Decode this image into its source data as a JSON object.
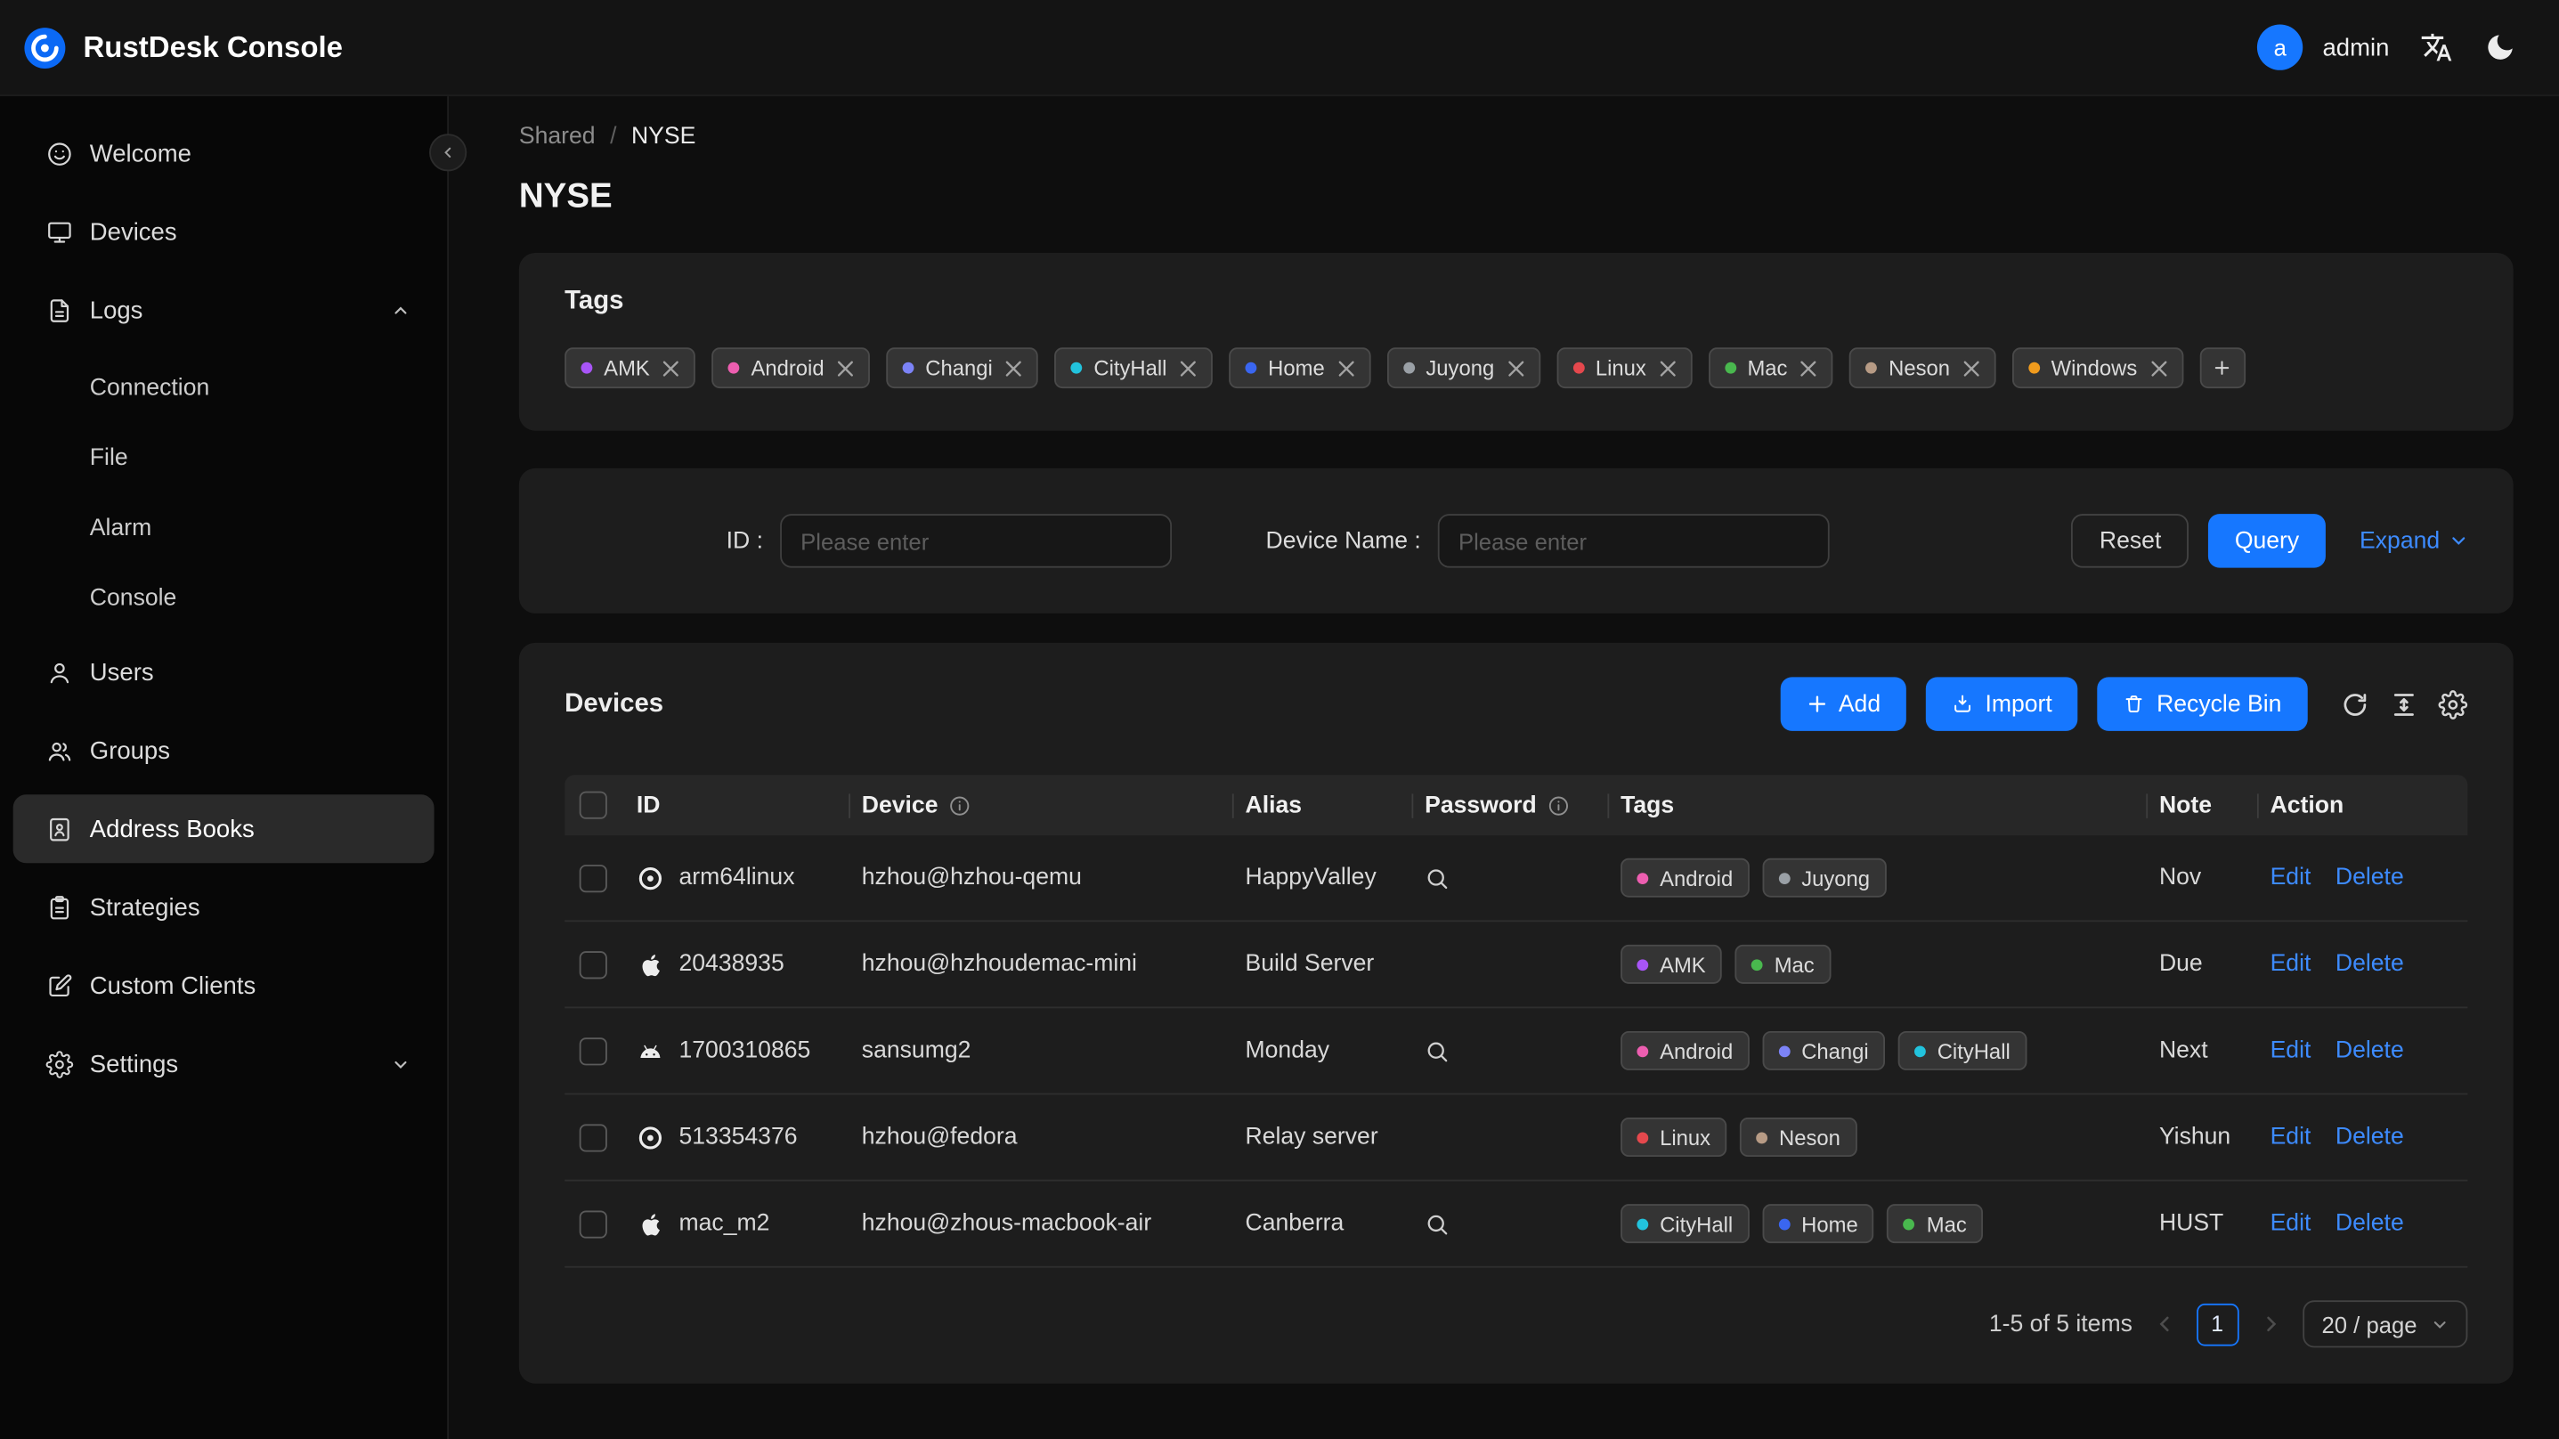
{
  "header": {
    "title": "RustDesk Console",
    "user_initial": "a",
    "user_name": "admin"
  },
  "sidebar": {
    "items": [
      {
        "label": "Welcome",
        "icon": "smiley-icon"
      },
      {
        "label": "Devices",
        "icon": "monitor-icon"
      },
      {
        "label": "Logs",
        "icon": "document-icon",
        "expanded": true
      },
      {
        "label": "Users",
        "icon": "user-icon"
      },
      {
        "label": "Groups",
        "icon": "users-icon"
      },
      {
        "label": "Address Books",
        "icon": "address-book-icon",
        "active": true
      },
      {
        "label": "Strategies",
        "icon": "clipboard-icon"
      },
      {
        "label": "Custom Clients",
        "icon": "edit-square-icon"
      },
      {
        "label": "Settings",
        "icon": "gear-icon",
        "collapsed": true
      }
    ],
    "logs_submenu": [
      {
        "label": "Connection"
      },
      {
        "label": "File"
      },
      {
        "label": "Alarm"
      },
      {
        "label": "Console"
      }
    ],
    "active_item": "Address Books"
  },
  "breadcrumb": {
    "parent": "Shared",
    "separator": "/",
    "current": "NYSE"
  },
  "page_title": "NYSE",
  "tags_card": {
    "title": "Tags",
    "tags": [
      {
        "label": "AMK",
        "color": "#a855f7"
      },
      {
        "label": "Android",
        "color": "#ed5eb0"
      },
      {
        "label": "Changi",
        "color": "#7c83f7"
      },
      {
        "label": "CityHall",
        "color": "#22c3dd"
      },
      {
        "label": "Home",
        "color": "#3a66f0"
      },
      {
        "label": "Juyong",
        "color": "#9aa0a6"
      },
      {
        "label": "Linux",
        "color": "#e5484d"
      },
      {
        "label": "Mac",
        "color": "#49b84e"
      },
      {
        "label": "Neson",
        "color": "#b79b85"
      },
      {
        "label": "Windows",
        "color": "#f09b1d"
      }
    ]
  },
  "filter": {
    "id_label": "ID :",
    "id_placeholder": "Please enter",
    "device_label": "Device Name :",
    "device_placeholder": "Please enter",
    "reset": "Reset",
    "query": "Query",
    "expand": "Expand"
  },
  "devices": {
    "title": "Devices",
    "add": "Add",
    "import": "Import",
    "recycle_bin": "Recycle Bin",
    "columns": {
      "id": "ID",
      "device": "Device",
      "alias": "Alias",
      "password": "Password",
      "tags": "Tags",
      "note": "Note",
      "action": "Action"
    },
    "actions": {
      "edit": "Edit",
      "delete": "Delete"
    },
    "rows": [
      {
        "os_icon": "linux-os-icon",
        "id": "arm64linux",
        "device": "hzhou@hzhou-qemu",
        "alias": "HappyValley",
        "password_hidden": true,
        "tags": [
          {
            "label": "Android",
            "color": "#ed5eb0"
          },
          {
            "label": "Juyong",
            "color": "#9aa0a6"
          }
        ],
        "note": "Nov"
      },
      {
        "os_icon": "apple-icon",
        "id": "20438935",
        "device": "hzhou@hzhoudemac-mini",
        "alias": "Build Server",
        "password_hidden": false,
        "tags": [
          {
            "label": "AMK",
            "color": "#a855f7"
          },
          {
            "label": "Mac",
            "color": "#49b84e"
          }
        ],
        "note": "Due"
      },
      {
        "os_icon": "android-icon",
        "id": "1700310865",
        "device": "sansumg2",
        "alias": "Monday",
        "password_hidden": true,
        "tags": [
          {
            "label": "Android",
            "color": "#ed5eb0"
          },
          {
            "label": "Changi",
            "color": "#7c83f7"
          },
          {
            "label": "CityHall",
            "color": "#22c3dd"
          }
        ],
        "note": "Next"
      },
      {
        "os_icon": "linux-os-icon",
        "id": "513354376",
        "device": "hzhou@fedora",
        "alias": "Relay server",
        "password_hidden": false,
        "tags": [
          {
            "label": "Linux",
            "color": "#e5484d"
          },
          {
            "label": "Neson",
            "color": "#b79b85"
          }
        ],
        "note": "Yishun"
      },
      {
        "os_icon": "apple-icon",
        "id": "mac_m2",
        "device": "hzhou@zhous-macbook-air",
        "alias": "Canberra",
        "password_hidden": true,
        "tags": [
          {
            "label": "CityHall",
            "color": "#22c3dd"
          },
          {
            "label": "Home",
            "color": "#3a66f0"
          },
          {
            "label": "Mac",
            "color": "#49b84e"
          }
        ],
        "note": "HUST"
      }
    ],
    "pagination": {
      "summary": "1-5 of 5 items",
      "page": "1",
      "page_size": "20 / page"
    }
  },
  "icons": {
    "logo": "rustdesk-logo",
    "header": [
      "translate-icon",
      "moon-icon"
    ],
    "sidebar": [
      "smiley-icon",
      "monitor-icon",
      "document-icon",
      "user-icon",
      "users-icon",
      "address-book-icon",
      "clipboard-icon",
      "edit-square-icon",
      "gear-icon",
      "chevron-up-icon",
      "chevron-down-icon",
      "chevron-left-icon"
    ],
    "toolbar": [
      "plus-icon",
      "import-icon",
      "trash-icon",
      "refresh-icon",
      "column-height-icon",
      "gear-icon"
    ],
    "table": [
      "info-icon",
      "search-icon",
      "apple-icon",
      "android-icon",
      "linux-os-icon"
    ],
    "chip": [
      "close-icon"
    ]
  },
  "colors": {
    "accent": "#1677ff",
    "link": "#3d8bff",
    "card_bg": "#1d1d1d"
  }
}
